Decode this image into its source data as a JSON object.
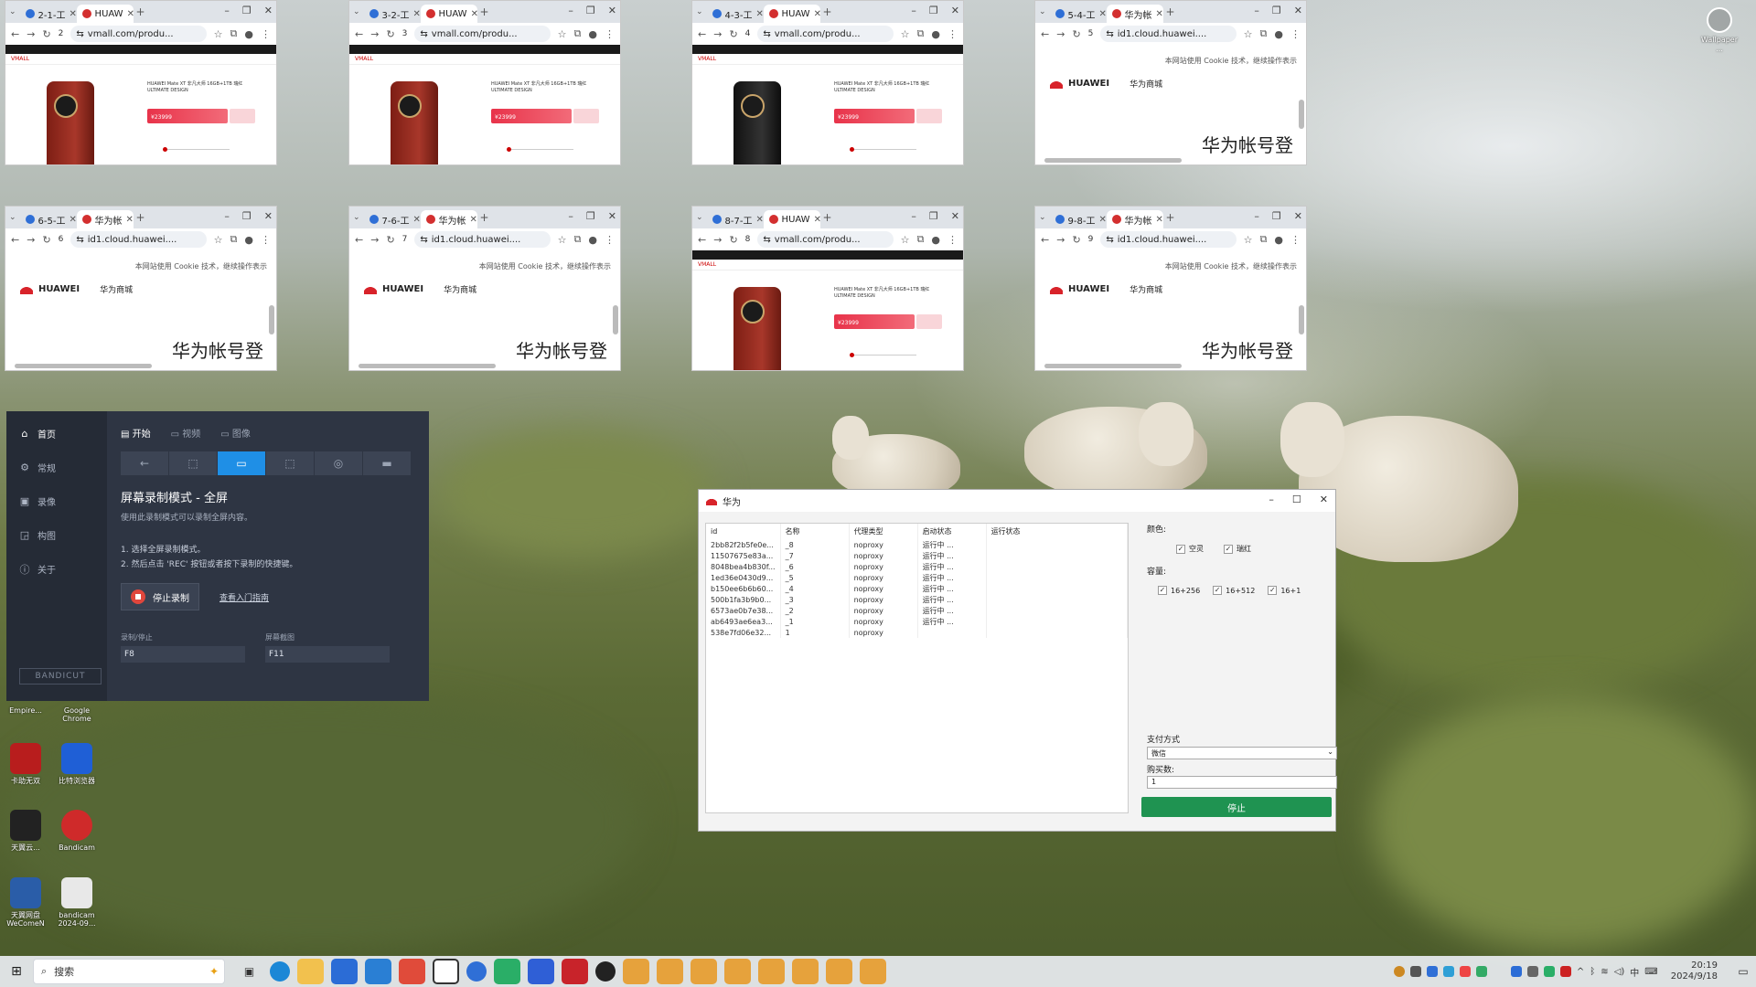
{
  "browsers": [
    {
      "tab1": "2-1-工",
      "tab2": "HUAW",
      "num": "2",
      "url": "vmall.com/produ...",
      "kind": "vmall",
      "phone": "red"
    },
    {
      "tab1": "3-2-工",
      "tab2": "HUAW",
      "num": "3",
      "url": "vmall.com/produ...",
      "kind": "vmall",
      "phone": "red"
    },
    {
      "tab1": "4-3-工",
      "tab2": "HUAW",
      "num": "4",
      "url": "vmall.com/produ...",
      "kind": "vmall",
      "phone": "black"
    },
    {
      "tab1": "5-4-工",
      "tab2": "华为帐",
      "num": "5",
      "url": "id1.cloud.huawei....",
      "kind": "login"
    },
    {
      "tab1": "6-5-工",
      "tab2": "华为帐",
      "num": "6",
      "url": "id1.cloud.huawei....",
      "kind": "login"
    },
    {
      "tab1": "7-6-工",
      "tab2": "华为帐",
      "num": "7",
      "url": "id1.cloud.huawei....",
      "kind": "login"
    },
    {
      "tab1": "8-7-工",
      "tab2": "HUAW",
      "num": "8",
      "url": "vmall.com/produ...",
      "kind": "vmall",
      "phone": "red"
    },
    {
      "tab1": "9-8-工",
      "tab2": "华为帐",
      "num": "9",
      "url": "id1.cloud.huawei....",
      "kind": "login"
    }
  ],
  "vmall": {
    "logo": "VMALL",
    "title": "HUAWEI Mate XT 非凡大师 16GB+1TB 瑞红 ULTIMATE DESIGN",
    "price_label": "¥23999"
  },
  "huawei_login": {
    "cookie_notice": "本网站使用 Cookie 技术，继续操作表示",
    "logo": "HUAWEI",
    "mall": "华为商城",
    "heading": "华为帐号登"
  },
  "bandicut": {
    "nav": [
      {
        "label": "首页",
        "icon": "home-icon"
      },
      {
        "label": "常规",
        "icon": "gear-icon"
      },
      {
        "label": "录像",
        "icon": "video-icon"
      },
      {
        "label": "构图",
        "icon": "image-icon"
      },
      {
        "label": "关于",
        "icon": "info-icon"
      }
    ],
    "brand": "BANDICUT",
    "tabs": [
      "开始",
      "视频",
      "图像"
    ],
    "mode_title": "屏幕录制模式 - 全屏",
    "mode_desc": "使用此录制模式可以录制全屏内容。",
    "steps": [
      "1. 选择全屏录制模式。",
      "2. 然后点击 'REC' 按钮或者按下录制的快捷键。"
    ],
    "stop_label": "停止录制",
    "link_label": "查看入门指南",
    "hotkey_rec_label": "录制/停止",
    "hotkey_rec_value": "F8",
    "hotkey_shot_label": "屏幕截图",
    "hotkey_shot_value": "F11"
  },
  "tool": {
    "title": "华为",
    "columns": [
      "id",
      "名称",
      "代理类型",
      "启动状态",
      "运行状态"
    ],
    "rows": [
      {
        "id": "2bb82f2b5fe0e...",
        "name": "_8",
        "proxy": "noproxy",
        "status": "运行中 ..."
      },
      {
        "id": "11507675e83a...",
        "name": "_7",
        "proxy": "noproxy",
        "status": "运行中 ..."
      },
      {
        "id": "8048bea4b830f...",
        "name": "_6",
        "proxy": "noproxy",
        "status": "运行中 ..."
      },
      {
        "id": "1ed36e0430d9...",
        "name": "_5",
        "proxy": "noproxy",
        "status": "运行中 ..."
      },
      {
        "id": "b150ee6b6b60...",
        "name": "_4",
        "proxy": "noproxy",
        "status": "运行中 ..."
      },
      {
        "id": "500b1fa3b9b0...",
        "name": "_3",
        "proxy": "noproxy",
        "status": "运行中 ..."
      },
      {
        "id": "6573ae0b7e38...",
        "name": "_2",
        "proxy": "noproxy",
        "status": "运行中 ..."
      },
      {
        "id": "ab6493ae6ea3...",
        "name": "_1",
        "proxy": "noproxy",
        "status": "运行中 ..."
      },
      {
        "id": "538e7fd06e32...",
        "name": "1",
        "proxy": "noproxy",
        "status": ""
      }
    ],
    "color_label": "颜色:",
    "colors": [
      "空灵",
      "瑞红"
    ],
    "capacity_label": "容量:",
    "capacities": [
      "16+256",
      "16+512",
      "16+1"
    ],
    "pay_label": "支付方式",
    "pay_value": "微信",
    "qty_label": "购买数:",
    "qty_value": "1",
    "stop_button": "停止"
  },
  "desktop_icons": [
    {
      "label": "Empire..."
    },
    {
      "label": "Google Chrome"
    },
    {
      "label": "卡助无双"
    },
    {
      "label": "比特浏览器"
    },
    {
      "label": "天翼云..."
    },
    {
      "label": "Bandicam"
    },
    {
      "label": "天翼网盘 WeComeN"
    },
    {
      "label": "bandicam 2024-09..."
    }
  ],
  "user_widget": {
    "label": "Wallpaper ..."
  },
  "taskbar": {
    "search_placeholder": "搜索",
    "time": "20:19",
    "date": "2024/9/18"
  }
}
